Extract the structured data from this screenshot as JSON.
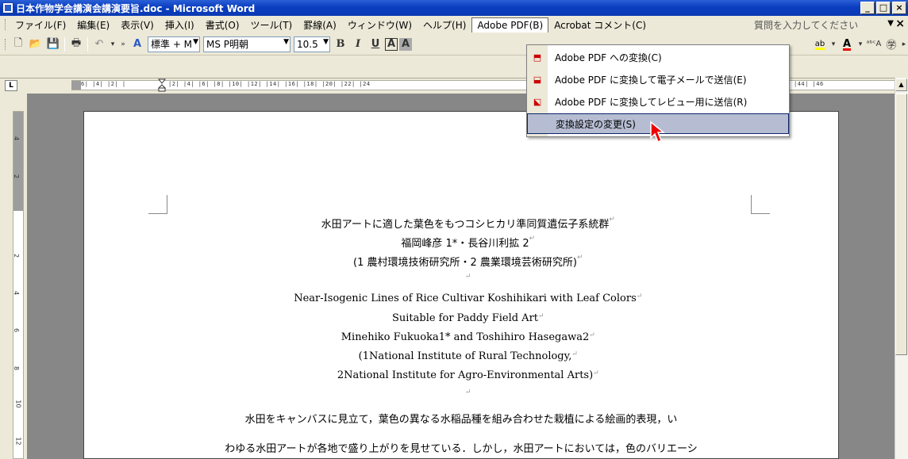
{
  "window": {
    "title": "日本作物学会講演会講演要旨.doc - Microsoft Word",
    "controls": [
      "_",
      "□",
      "×"
    ]
  },
  "menubar": {
    "items": [
      "ファイル(F)",
      "編集(E)",
      "表示(V)",
      "挿入(I)",
      "書式(O)",
      "ツール(T)",
      "罫線(A)",
      "ウィンドウ(W)",
      "ヘルプ(H)",
      "Adobe PDF(B)",
      "Acrobat コメント(C)"
    ],
    "help_placeholder": "質問を入力してください",
    "close": "×"
  },
  "toolbar": {
    "style_value": "標準 + M",
    "font_value": "MS P明朝",
    "size_value": "10.5",
    "bold": "B",
    "italic": "I",
    "underline": "U",
    "char_border": "A",
    "char_shade": "A"
  },
  "ruler": {
    "ticks": "6| |4| |2| |",
    "ticks2": "|2| |4| |6| |8| |10| |12| |14| |16| |18| |20| |22| |24",
    "ticks3": "|44| |46",
    "corner": "L",
    "vlabels": [
      "4",
      "2",
      "2",
      "4",
      "6",
      "8",
      "10",
      "12"
    ]
  },
  "dropdown": {
    "items": [
      {
        "label": "Adobe PDF への変換(C)",
        "icon": "pdf-icon"
      },
      {
        "label": "Adobe PDF に変換して電子メールで送信(E)",
        "icon": "pdf-mail-icon"
      },
      {
        "label": "Adobe PDF に変換してレビュー用に送信(R)",
        "icon": "pdf-review-icon"
      },
      {
        "label": "変換設定の変更(S)",
        "icon": ""
      }
    ]
  },
  "document": {
    "lines": [
      "水田アートに適した葉色をもつコシヒカリ準同質遺伝子系統群",
      "福岡峰彦 1*・長谷川利拡 2",
      "(1 農村環境技術研究所・2 農業環境芸術研究所)",
      "",
      "Near-Isogenic Lines of Rice Cultivar Koshihikari with Leaf Colors",
      "Suitable for Paddy Field Art",
      "Minehiko Fukuoka1* and Toshihiro Hasegawa2",
      "(1National Institute of Rural Technology,",
      "2National Institute for Agro-Environmental Arts)",
      "",
      "水田をキャンバスに見立て，葉色の異なる水稲品種を組み合わせた栽植による絵画的表現，い",
      "わゆる水田アートが各地で盛り上がりを見せている．しかし，水田アートにおいては，色のバリエーシ"
    ],
    "para_mark": "↵"
  },
  "colors": {
    "titlebar": "#0a3ec0",
    "highlight": "#b6bdd2",
    "desktop_gray": "#878787"
  }
}
